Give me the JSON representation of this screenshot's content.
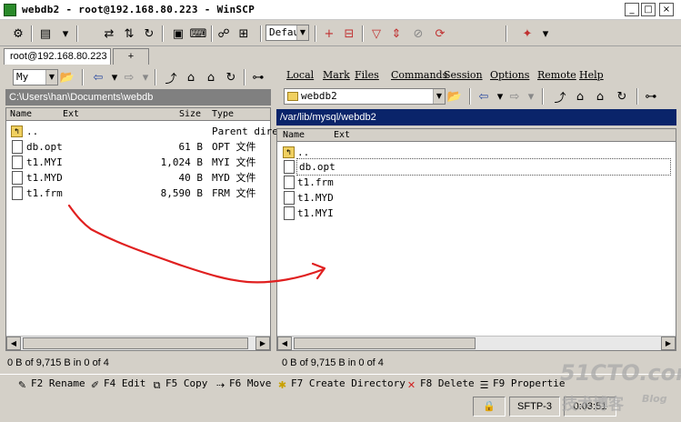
{
  "window": {
    "title": "webdb2 - root@192.168.80.223 - WinSCP",
    "minimize": "_",
    "maximize": "□",
    "close": "×"
  },
  "toolbar": {
    "transfer_preset": "Defau"
  },
  "tabs": [
    {
      "label": "root@192.168.80.223"
    },
    {
      "label": "+"
    }
  ],
  "left": {
    "drive_combo": "My",
    "path": "C:\\Users\\han\\Documents\\webdb",
    "columns": {
      "name": "Name",
      "ext": "Ext",
      "size": "Size",
      "type": "Type"
    },
    "files": [
      {
        "name": "..",
        "size": "",
        "type": "Parent dire"
      },
      {
        "name": "db.opt",
        "size": "61 B",
        "type": "OPT 文件"
      },
      {
        "name": "t1.MYI",
        "size": "1,024 B",
        "type": "MYI 文件"
      },
      {
        "name": "t1.MYD",
        "size": "40 B",
        "type": "MYD 文件"
      },
      {
        "name": "t1.frm",
        "size": "8,590 B",
        "type": "FRM 文件"
      }
    ],
    "status": "0 B of 9,715 B in 0 of 4"
  },
  "right": {
    "menu": [
      "Local",
      "Mark",
      "Files",
      "Commands",
      "Session",
      "Options",
      "Remote",
      "Help"
    ],
    "dir_combo": "webdb2",
    "path": "/var/lib/mysql/webdb2",
    "columns": {
      "name": "Name",
      "ext": "Ext"
    },
    "files": [
      {
        "name": ".."
      },
      {
        "name": "db.opt"
      },
      {
        "name": "t1.frm"
      },
      {
        "name": "t1.MYD"
      },
      {
        "name": "t1.MYI"
      }
    ],
    "status": "0 B of 9,715 B in 0 of 4"
  },
  "fkeys": [
    {
      "label": "F2 Rename",
      "icon": "rename-icon"
    },
    {
      "label": "F4 Edit",
      "icon": "edit-icon"
    },
    {
      "label": "F5 Copy",
      "icon": "copy-icon"
    },
    {
      "label": "F6 Move",
      "icon": "move-icon"
    },
    {
      "label": "F7 Create Directory",
      "icon": "new-folder-icon"
    },
    {
      "label": "F8 Delete",
      "icon": "delete-icon"
    },
    {
      "label": "F9 Propertie",
      "icon": "properties-icon"
    }
  ],
  "statusbar": {
    "protocol": "SFTP-3",
    "time": "0:03:51"
  },
  "watermark": {
    "site": "51CTO.com",
    "tagline": "技术博客",
    "blog": "Blog"
  },
  "colors": {
    "path_active": "#0a246a",
    "path_inactive": "#808080",
    "annotation": "#e02020"
  }
}
